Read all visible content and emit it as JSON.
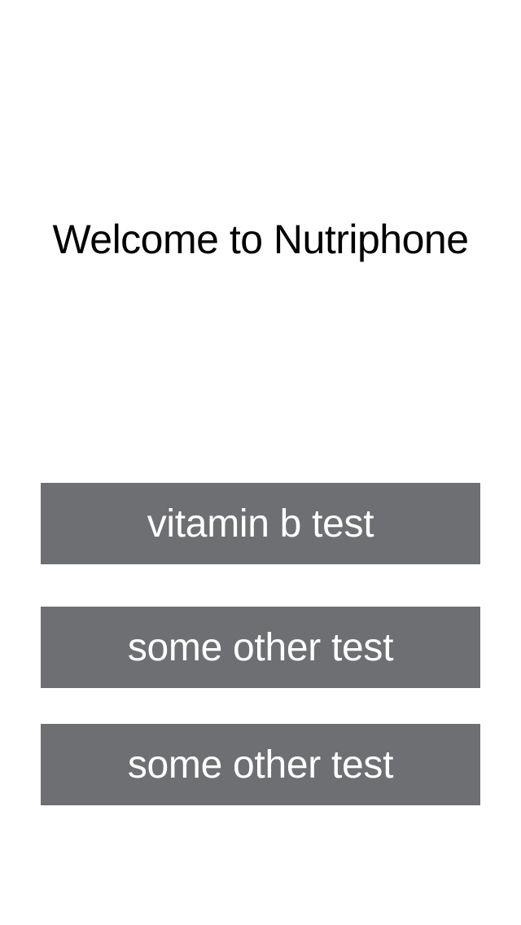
{
  "welcome": {
    "title": "Welcome to Nutriphone"
  },
  "buttons": [
    {
      "label": "vitamin b test"
    },
    {
      "label": "some other test"
    },
    {
      "label": "some other test"
    }
  ],
  "colors": {
    "background": "#ffffff",
    "button_background": "#6e6f73",
    "button_text": "#ffffff",
    "title_text": "#000000"
  }
}
